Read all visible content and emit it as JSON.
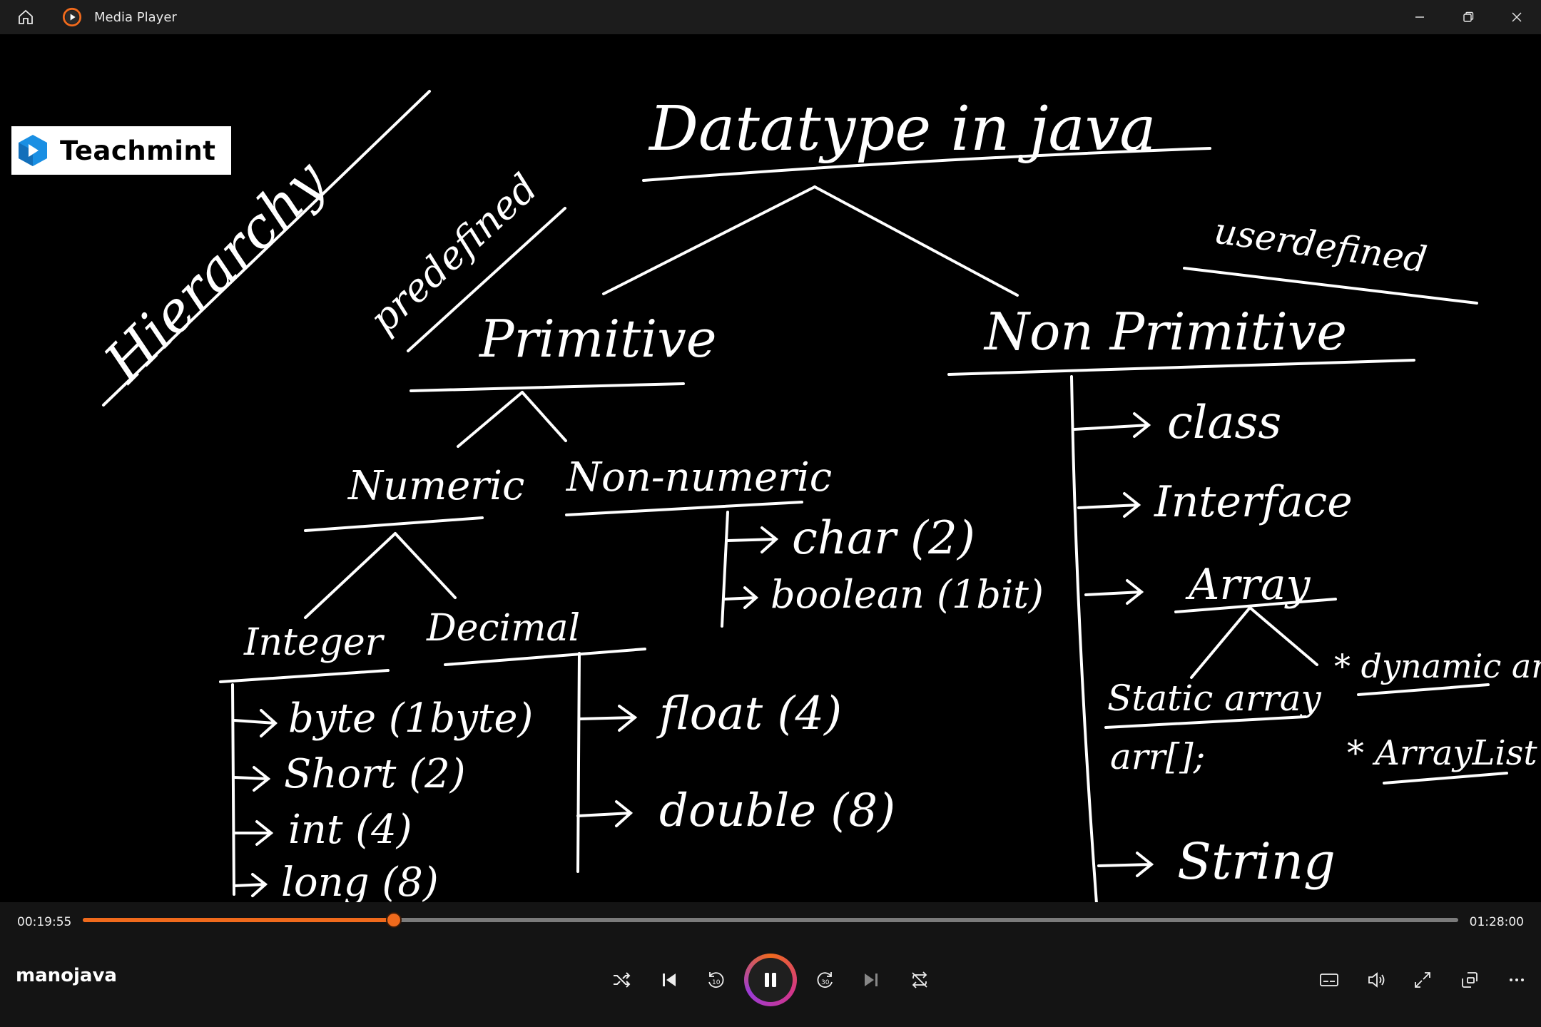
{
  "window": {
    "title": "Media Player"
  },
  "player": {
    "current_time": "00:19:55",
    "duration": "01:28:00",
    "progress": 0.226,
    "media_title": "manojava",
    "accent_color": "#f06a1c"
  },
  "video": {
    "logo_text": "Teachmint",
    "board": {
      "title": "Datatype in java",
      "hierarchy": "Hierarchy",
      "predefined": "predefined",
      "userdefined": "userdefined",
      "primitive": "Primitive",
      "non_primitive": "Non Primitive",
      "numeric": "Numeric",
      "non_numeric": "Non-numeric",
      "integer": "Integer",
      "decimal": "Decimal",
      "int_types": [
        "byte (1byte)",
        "Short (2)",
        "int (4)",
        "long (8)"
      ],
      "decimal_types": [
        "float (4)",
        "double (8)"
      ],
      "non_numeric_types": [
        "char (2)",
        "boolean (1bit)"
      ],
      "non_primitive_types": [
        "class",
        "Interface",
        "Array",
        "String"
      ],
      "array_types": [
        "Static array",
        "arr[];",
        "* dynamic array",
        "* ArrayList"
      ]
    }
  },
  "icons": {
    "home": "home-icon",
    "app": "media-player-icon",
    "minimize": "minimize-icon",
    "restore": "restore-icon",
    "close": "close-icon",
    "shuffle": "shuffle-icon",
    "previous": "previous-icon",
    "skip_back": "skip-back-10-icon",
    "pause": "pause-icon",
    "skip_forward": "skip-forward-30-icon",
    "next": "next-icon",
    "repeat": "repeat-off-icon",
    "subtitles": "subtitles-icon",
    "volume": "volume-icon",
    "fullscreen": "fullscreen-icon",
    "miniplayer": "miniplayer-icon",
    "more": "more-icon"
  }
}
